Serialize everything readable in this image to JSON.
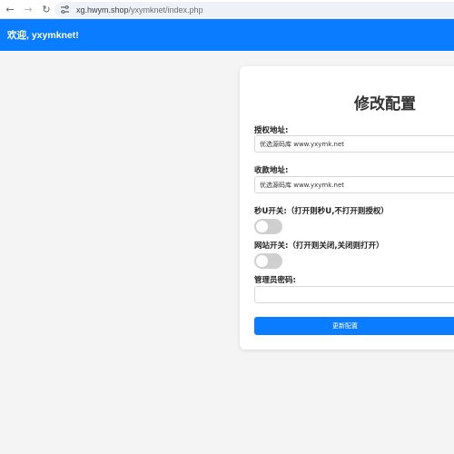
{
  "browser": {
    "url_host": "xg.hwym.shop",
    "url_path": "/yxymknet/index.php"
  },
  "topbar": {
    "welcome": "欢迎, yxymknet!"
  },
  "form": {
    "title": "修改配置",
    "auth_label": "授权地址:",
    "auth_value": "优选源码库  www.yxymk.net",
    "pay_label": "收款地址:",
    "pay_value": "优选源码库  www.yxymk.net",
    "secu_label": "秒U开关:（打开则秒U,不打开则授权）",
    "secu_on": false,
    "site_label": "网站开关:（打开则关闭,关闭则打开）",
    "site_on": false,
    "admin_pwd_label": "管理员密码:",
    "admin_pwd_value": "",
    "save_label": "更新配置"
  },
  "colors": {
    "accent": "#0a7cff",
    "toggle_off": "#cfcfcf"
  }
}
